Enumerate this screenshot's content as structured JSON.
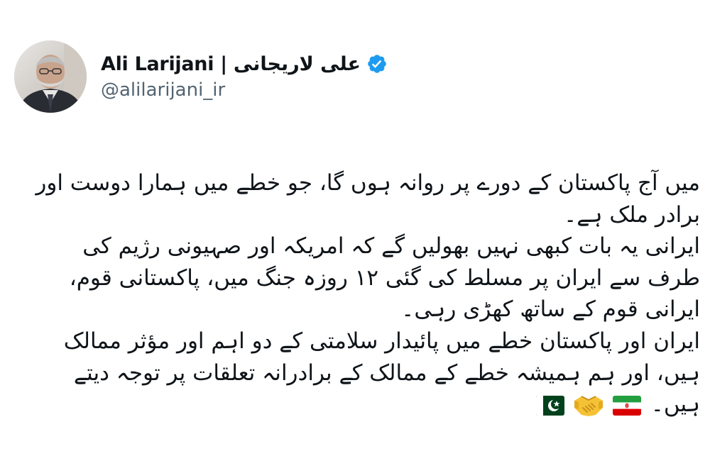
{
  "author": {
    "display_name": "Ali Larijani | علی لاریجانی",
    "handle": "@alilarijani_ir",
    "verified": true
  },
  "tweet": {
    "paragraphs": [
      "میں آج پاکستان کے دورے پر روانہ ہوں گا، جو خطے میں ہمارا دوست اور برادر ملک ہے۔",
      "ایرانی یہ بات کبھی نہیں بھولیں گے کہ امریکہ اور صہیونی رژیم کی طرف سے ایران پر مسلط کی گئی ۱۲ روزہ جنگ میں، پاکستانی قوم، ایرانی قوم کے ساتھ کھڑی رہی۔",
      "ایران اور پاکستان خطے میں پائیدار سلامتی کے دو اہم اور مؤثر ممالک ہیں، اور ہم ہمیشہ خطے کے ممالک کے برادرانہ تعلقات پر توجہ دیتے ہیں۔"
    ],
    "emoji": [
      "iran-flag",
      "handshake",
      "pakistan-flag"
    ]
  },
  "colors": {
    "text": "#0f1419",
    "secondary": "#536471",
    "verified": "#1d9bf0",
    "iran_green": "#239f40",
    "iran_red": "#da0000",
    "pakistan_green": "#01411c"
  }
}
